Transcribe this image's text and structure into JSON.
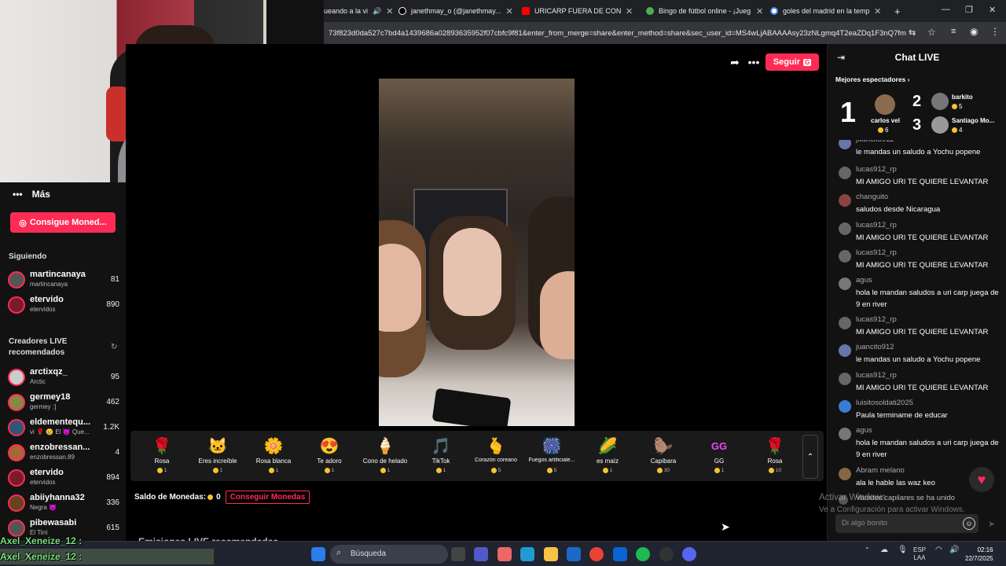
{
  "browser": {
    "tabs": [
      {
        "label": "ueando a la vi",
        "icon": "speaker-icon"
      },
      {
        "label": "janethmay_o (@janethmay...",
        "icon": "tiktok-icon"
      },
      {
        "label": "URICARP FUERA DE CONTEXTO",
        "icon": "youtube-icon"
      },
      {
        "label": "Bingo de fútbol online - ¡Jueg...",
        "icon": "web-icon"
      },
      {
        "label": "goles del madrid en la tempor...",
        "icon": "google-icon"
      }
    ],
    "new_tab": "+",
    "url": "73f823d0da527c7bd4a1439686a02893635952f07cbfc9f81&enter_from_merge=share&enter_method=share&sec_user_id=MS4wLjABAAAAsy23zNLgmq4T2eaZDq1F3nQ7fmdY..."
  },
  "sidebar": {
    "more_label": "Más",
    "coins_button": "Consigue Moned...",
    "following_title": "Siguiendo",
    "following": [
      {
        "name": "martincanaya",
        "sub": "martincanaya",
        "count": "81"
      },
      {
        "name": "etervido",
        "sub": "etervidos",
        "count": "890"
      }
    ],
    "recommended_title": "Creadores LIVE recomendados",
    "recommended": [
      {
        "name": "arctixqz_",
        "sub": "Arctic",
        "count": "95"
      },
      {
        "name": "germey18",
        "sub": "germey :]",
        "count": "462"
      },
      {
        "name": "eldementequ...",
        "sub": "vi 🌹 😢 El 😈 Que...",
        "count": "1.2K"
      },
      {
        "name": "enzobressan...",
        "sub": "enzobressan.89",
        "count": "4"
      },
      {
        "name": "etervido",
        "sub": "etervidos",
        "count": "894"
      },
      {
        "name": "abiiyhanna32",
        "sub": "Negra 😈",
        "count": "336"
      },
      {
        "name": "pibewasabi",
        "sub": "El Tirri",
        "count": "615"
      }
    ]
  },
  "stream_header": {
    "follow_label": "Seguir",
    "follow_badge": "G"
  },
  "gifts": [
    {
      "name": "Rosa",
      "price": "1",
      "icon": "🌹"
    },
    {
      "name": "Eres increíble",
      "price": "1",
      "icon": "🐱"
    },
    {
      "name": "Rosa blanca",
      "price": "1",
      "icon": "🌼"
    },
    {
      "name": "Te adoro",
      "price": "1",
      "icon": "😍"
    },
    {
      "name": "Cono de helado",
      "price": "1",
      "icon": "🍦"
    },
    {
      "name": "TikTok",
      "price": "1",
      "icon": "🎵"
    },
    {
      "name": "Corazón coreano",
      "price": "5",
      "icon": "🫰"
    },
    {
      "name": "Fuegos artificiale...",
      "price": "5",
      "icon": "🎆"
    },
    {
      "name": "es maíz",
      "price": "1",
      "icon": "🌽"
    },
    {
      "name": "Capibara",
      "price": "30",
      "icon": "🦫"
    },
    {
      "name": "GG",
      "price": "1",
      "icon": "GG"
    },
    {
      "name": "Rosa",
      "price": "10",
      "icon": "🌹"
    }
  ],
  "balance": {
    "label": "Saldo de Monedas:",
    "value": "0",
    "get_label": "Conseguir Monedas"
  },
  "recommended_header": "Emisiones LIVE recomendadas",
  "chat": {
    "title": "Chat LIVE",
    "top_viewers_label": "Mejores espectadores",
    "top_viewers": [
      {
        "rank": "1",
        "name": "carlos vel",
        "count": "6"
      },
      {
        "rank": "2",
        "name": "barkito",
        "count": "5"
      },
      {
        "rank": "3",
        "name": "Santiago Mo...",
        "count": "4"
      }
    ],
    "messages": [
      {
        "user": "juancito912",
        "text": "le mandas un saludo a Yochu popene"
      },
      {
        "user": "lucas912_rp",
        "text": "MI AMIGO URI TE QUIERE LEVANTAR"
      },
      {
        "user": "changuito",
        "text": "saludos desde Nicaragua"
      },
      {
        "user": "lucas912_rp",
        "text": "MI AMIGO URI TE QUIERE LEVANTAR"
      },
      {
        "user": "lucas912_rp",
        "text": "MI AMIGO URI TE QUIERE LEVANTAR"
      },
      {
        "user": "agus",
        "text": "hola le mandan saludos a uri carp juega de 9 en river"
      },
      {
        "user": "lucas912_rp",
        "text": "MI AMIGO URI TE QUIERE LEVANTAR"
      },
      {
        "user": "juancito912",
        "text": "le mandas un saludo a Yochu popene"
      },
      {
        "user": "lucas912_rp",
        "text": "MI AMIGO URI TE QUIERE LEVANTAR"
      },
      {
        "user": "luisitosoldati2025",
        "text": "Paula terminame de educar"
      },
      {
        "user": "agus",
        "text": "hola le mandan saludos a uri carp juega de 9 en river"
      },
      {
        "user": "Abram melano",
        "text": "ala le hable las waz keo"
      }
    ],
    "join_notice": "Vamitos capilares se ha unido",
    "input_placeholder": "Di algo bonito"
  },
  "windows": {
    "activate_title": "Activar Windows",
    "activate_sub": "Ve a Configuración para activar Windows."
  },
  "taskbar": {
    "search_placeholder": "Búsqueda",
    "lang": "ESP",
    "lang2": "LAA",
    "time": "02:16",
    "date": "22/7/2025"
  },
  "overlay": {
    "names": [
      "Axel_Xeneize_12 :",
      "Axel_Xeneize_12 :"
    ]
  }
}
